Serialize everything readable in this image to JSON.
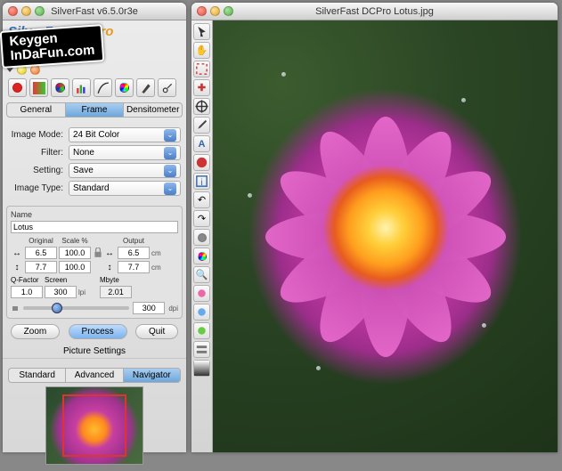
{
  "left_window": {
    "title": "SilverFast v6.5.0r3e"
  },
  "logo": {
    "silver": "SilverFast",
    "dc": "DCPro"
  },
  "keygen_overlay": {
    "line1": "Keygen",
    "line2": "InDaFun.com"
  },
  "toolbar_icons": [
    "red",
    "yellow",
    "green",
    "blue",
    "cyan",
    "violet",
    "gray",
    "dark"
  ],
  "main_tabs": {
    "items": [
      "General",
      "Frame",
      "Densitometer"
    ],
    "active": 1
  },
  "form": {
    "image_mode": {
      "label": "Image Mode:",
      "value": "24 Bit Color"
    },
    "filter": {
      "label": "Filter:",
      "value": "None"
    },
    "setting": {
      "label": "Setting:",
      "value": "Save"
    },
    "image_type": {
      "label": "Image Type:",
      "value": "Standard"
    }
  },
  "name_group": {
    "label": "Name",
    "value": "Lotus"
  },
  "dims": {
    "headers": {
      "original": "Original",
      "scale": "Scale %",
      "output": "Output"
    },
    "row1": {
      "orig": "6.5",
      "scale": "100.0",
      "out": "6.5",
      "unit": "cm"
    },
    "row2": {
      "orig": "7.7",
      "scale": "100.0",
      "out": "7.7",
      "unit": "cm"
    },
    "qf_label": "Q-Factor",
    "screen_label": "Screen",
    "mb_label": "Mbyte",
    "qf": "1.0",
    "screen": "300",
    "screen_unit": "lpi",
    "mb": "2.01",
    "res": "300",
    "res_unit": "dpi"
  },
  "pills": {
    "zoom": "Zoom",
    "process": "Process",
    "quit": "Quit"
  },
  "picture_settings": {
    "label": "Picture Settings"
  },
  "nav_tabs": {
    "items": [
      "Standard",
      "Advanced",
      "Navigator"
    ],
    "active": 2
  },
  "right_window": {
    "title": "SilverFast DCPro Lotus.jpg"
  },
  "vtools": [
    "pointer",
    "hand",
    "crop",
    "plus",
    "target",
    "eyedrop",
    "text",
    "info",
    "ccw",
    "cw",
    "circle1",
    "circle2",
    "q1",
    "q2",
    "q3",
    "q4",
    "opt",
    "grad"
  ]
}
